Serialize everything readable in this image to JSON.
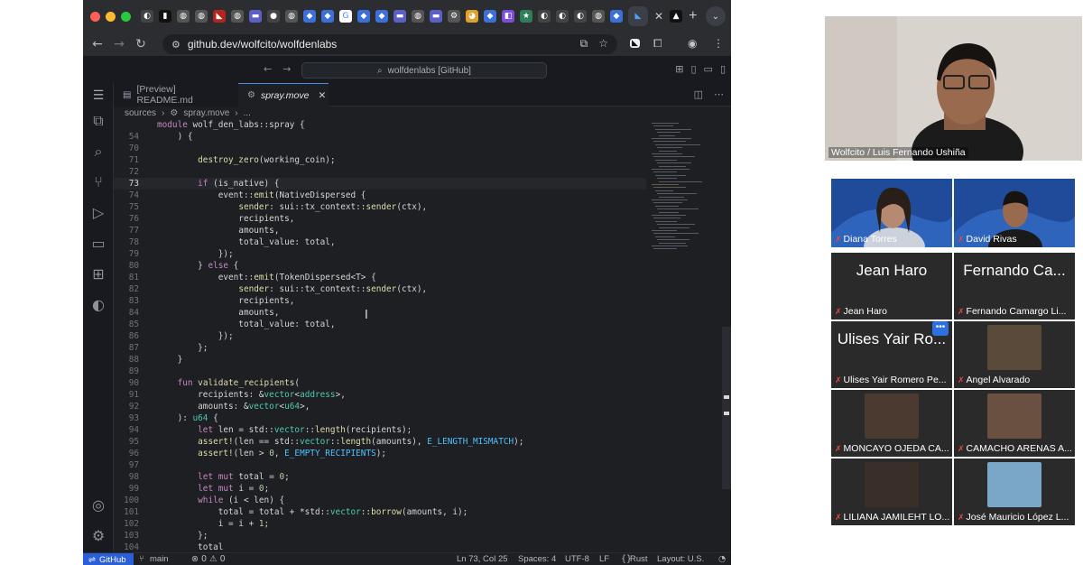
{
  "browser": {
    "url": "github.dev/wolfcito/wolfdenlabs",
    "tab_close": "✕",
    "tab_new": "+"
  },
  "vscode": {
    "title_search": "wolfdenlabs [GitHub]",
    "tabs": [
      {
        "label": "[Preview] README.md"
      },
      {
        "label": "spray.move"
      }
    ],
    "breadcrumb": [
      "sources",
      "spray.move",
      "..."
    ],
    "code_lines": [
      {
        "n": "",
        "t": "module wolf_den_labs::spray {"
      },
      {
        "n": "54",
        "t": "    ) {"
      },
      {
        "n": "70",
        "t": ""
      },
      {
        "n": "71",
        "t": "        destroy_zero(working_coin);"
      },
      {
        "n": "72",
        "t": ""
      },
      {
        "n": "73",
        "t": "        if (is_native) {"
      },
      {
        "n": "74",
        "t": "            event::emit(NativeDispersed {"
      },
      {
        "n": "75",
        "t": "                sender: sui::tx_context::sender(ctx),"
      },
      {
        "n": "76",
        "t": "                recipients,"
      },
      {
        "n": "77",
        "t": "                amounts,"
      },
      {
        "n": "78",
        "t": "                total_value: total,"
      },
      {
        "n": "79",
        "t": "            });"
      },
      {
        "n": "80",
        "t": "        } else {"
      },
      {
        "n": "81",
        "t": "            event::emit(TokenDispersed<T> {"
      },
      {
        "n": "82",
        "t": "                sender: sui::tx_context::sender(ctx),"
      },
      {
        "n": "83",
        "t": "                recipients,"
      },
      {
        "n": "84",
        "t": "                amounts,"
      },
      {
        "n": "85",
        "t": "                total_value: total,"
      },
      {
        "n": "86",
        "t": "            });"
      },
      {
        "n": "87",
        "t": "        };"
      },
      {
        "n": "88",
        "t": "    }"
      },
      {
        "n": "89",
        "t": ""
      },
      {
        "n": "90",
        "t": "    fun validate_recipients("
      },
      {
        "n": "91",
        "t": "        recipients: &vector<address>,"
      },
      {
        "n": "92",
        "t": "        amounts: &vector<u64>,"
      },
      {
        "n": "93",
        "t": "    ): u64 {"
      },
      {
        "n": "94",
        "t": "        let len = std::vector::length(recipients);"
      },
      {
        "n": "95",
        "t": "        assert!(len == std::vector::length(amounts), E_LENGTH_MISMATCH);"
      },
      {
        "n": "96",
        "t": "        assert!(len > 0, E_EMPTY_RECIPIENTS);"
      },
      {
        "n": "97",
        "t": ""
      },
      {
        "n": "98",
        "t": "        let mut total = 0;"
      },
      {
        "n": "99",
        "t": "        let mut i = 0;"
      },
      {
        "n": "100",
        "t": "        while (i < len) {"
      },
      {
        "n": "101",
        "t": "            total = total + *std::vector::borrow(amounts, i);"
      },
      {
        "n": "102",
        "t": "            i = i + 1;"
      },
      {
        "n": "103",
        "t": "        };"
      },
      {
        "n": "104",
        "t": "        total"
      }
    ],
    "status": {
      "remote": "GitHub",
      "branch": "main",
      "problems": "⊗ 0 ⚠ 0",
      "cursor": "Ln 73, Col 25",
      "spaces": "Spaces: 4",
      "encoding": "UTF-8",
      "eol": "LF",
      "language": "Rust",
      "layout": "Layout: U.S."
    }
  },
  "meeting": {
    "presenter": {
      "name": "Wolfcito / Luis Fernando Ushiña"
    },
    "participants": [
      {
        "name": "Diana Torres",
        "big": ""
      },
      {
        "name": "David Rivas",
        "big": ""
      },
      {
        "name": "Jean  Haro",
        "big": "Jean  Haro"
      },
      {
        "name": "Fernando Camargo Li...",
        "big": "Fernando Ca..."
      },
      {
        "name": "Ulises Yair Romero Pe...",
        "big": "Ulises Yair Ro..."
      },
      {
        "name": "Angel Alvarado",
        "big": ""
      },
      {
        "name": "MONCAYO OJEDA CA...",
        "big": ""
      },
      {
        "name": "CAMACHO ARENAS A...",
        "big": ""
      },
      {
        "name": "LILIANA JAMILEHT LO...",
        "big": ""
      },
      {
        "name": "José Mauricio López L...",
        "big": ""
      }
    ],
    "more_button": "•••"
  }
}
